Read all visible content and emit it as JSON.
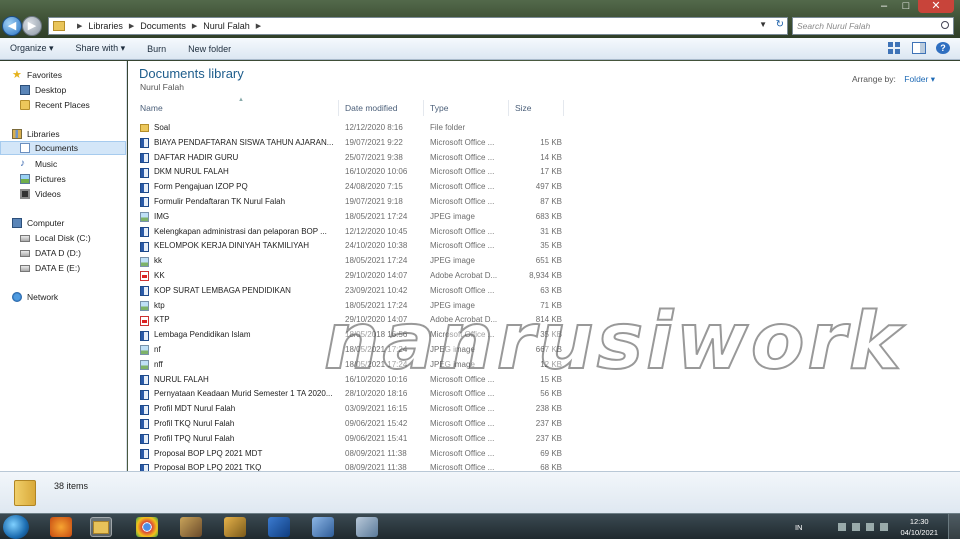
{
  "window": {
    "minimize": "–",
    "maximize": "□",
    "close": "✕"
  },
  "address": {
    "crumbs": [
      "Libraries",
      "Documents",
      "Nurul Falah"
    ],
    "search_placeholder": "Search Nurul Falah"
  },
  "toolbar": {
    "organize": "Organize ▾",
    "share_with": "Share with ▾",
    "burn": "Burn",
    "new_folder": "New folder"
  },
  "nav": {
    "favorites": "Favorites",
    "desktop": "Desktop",
    "recent_places": "Recent Places",
    "libraries": "Libraries",
    "documents": "Documents",
    "music": "Music",
    "pictures": "Pictures",
    "videos": "Videos",
    "computer": "Computer",
    "local_disk": "Local Disk (C:)",
    "data_d": "DATA D (D:)",
    "data_e": "DATA E (E:)",
    "network": "Network"
  },
  "content": {
    "title": "Documents library",
    "subtitle": "Nurul Falah",
    "arrange_label": "Arrange by:",
    "arrange_value": "Folder ▾",
    "columns": {
      "name": "Name",
      "date": "Date modified",
      "type": "Type",
      "size": "Size"
    },
    "files": [
      {
        "name": "Soal",
        "date": "12/12/2020 8:16",
        "type": "File folder",
        "size": "",
        "icon": "folder"
      },
      {
        "name": "BIAYA PENDAFTARAN SISWA TAHUN AJARAN...",
        "date": "19/07/2021 9:22",
        "type": "Microsoft Office ...",
        "size": "15 KB",
        "icon": "word"
      },
      {
        "name": "DAFTAR HADIR GURU",
        "date": "25/07/2021 9:38",
        "type": "Microsoft Office ...",
        "size": "14 KB",
        "icon": "word"
      },
      {
        "name": "DKM NURUL FALAH",
        "date": "16/10/2020 10:06",
        "type": "Microsoft Office ...",
        "size": "17 KB",
        "icon": "word"
      },
      {
        "name": "Form Pengajuan IZOP PQ",
        "date": "24/08/2020 7:15",
        "type": "Microsoft Office ...",
        "size": "497 KB",
        "icon": "word"
      },
      {
        "name": "Formulir Pendaftaran TK Nurul Falah",
        "date": "19/07/2021 9:18",
        "type": "Microsoft Office ...",
        "size": "87 KB",
        "icon": "word"
      },
      {
        "name": "IMG",
        "date": "18/05/2021 17:24",
        "type": "JPEG image",
        "size": "683 KB",
        "icon": "jpeg"
      },
      {
        "name": "Kelengkapan administrasi dan pelaporan BOP ...",
        "date": "12/12/2020 10:45",
        "type": "Microsoft Office ...",
        "size": "31 KB",
        "icon": "word"
      },
      {
        "name": "KELOMPOK KERJA DINIYAH TAKMILIYAH",
        "date": "24/10/2020 10:38",
        "type": "Microsoft Office ...",
        "size": "35 KB",
        "icon": "word"
      },
      {
        "name": "kk",
        "date": "18/05/2021 17:24",
        "type": "JPEG image",
        "size": "651 KB",
        "icon": "jpeg"
      },
      {
        "name": "KK",
        "date": "29/10/2020 14:07",
        "type": "Adobe Acrobat D...",
        "size": "8,934 KB",
        "icon": "pdf"
      },
      {
        "name": "KOP SURAT LEMBAGA PENDIDIKAN",
        "date": "23/09/2021 10:42",
        "type": "Microsoft Office ...",
        "size": "63 KB",
        "icon": "word"
      },
      {
        "name": "ktp",
        "date": "18/05/2021 17:24",
        "type": "JPEG image",
        "size": "71 KB",
        "icon": "jpeg"
      },
      {
        "name": "KTP",
        "date": "29/10/2020 14:07",
        "type": "Adobe Acrobat D...",
        "size": "814 KB",
        "icon": "pdf"
      },
      {
        "name": "Lembaga Pendidikan Islam",
        "date": "18/05/2018 16:56",
        "type": "Microsoft Office ...",
        "size": "35 KB",
        "icon": "word"
      },
      {
        "name": "nf",
        "date": "18/05/2021 17:24",
        "type": "JPEG image",
        "size": "667 KB",
        "icon": "jpeg"
      },
      {
        "name": "nff",
        "date": "18/05/2021 17:24",
        "type": "JPEG image",
        "size": "12 KB",
        "icon": "jpeg"
      },
      {
        "name": "NURUL FALAH",
        "date": "16/10/2020 10:16",
        "type": "Microsoft Office ...",
        "size": "15 KB",
        "icon": "word"
      },
      {
        "name": "Pernyataan Keadaan Murid Semester 1 TA 2020...",
        "date": "28/10/2020 18:16",
        "type": "Microsoft Office ...",
        "size": "56 KB",
        "icon": "word"
      },
      {
        "name": "Profil MDT Nurul Falah",
        "date": "03/09/2021 16:15",
        "type": "Microsoft Office ...",
        "size": "238 KB",
        "icon": "word"
      },
      {
        "name": "Profil TKQ Nurul Falah",
        "date": "09/06/2021 15:42",
        "type": "Microsoft Office ...",
        "size": "237 KB",
        "icon": "word"
      },
      {
        "name": "Profil TPQ Nurul Falah",
        "date": "09/06/2021 15:41",
        "type": "Microsoft Office ...",
        "size": "237 KB",
        "icon": "word"
      },
      {
        "name": "Proposal BOP LPQ 2021 MDT",
        "date": "08/09/2021 11:38",
        "type": "Microsoft Office ...",
        "size": "69 KB",
        "icon": "word"
      },
      {
        "name": "Proposal BOP LPQ 2021 TKQ",
        "date": "08/09/2021 11:38",
        "type": "Microsoft Office ...",
        "size": "68 KB",
        "icon": "word"
      }
    ],
    "watermark": "nanrusiwork"
  },
  "details": {
    "count": "38 items"
  },
  "taskbar": {
    "lang": "IN",
    "time": "12:30",
    "date": "04/10/2021"
  }
}
